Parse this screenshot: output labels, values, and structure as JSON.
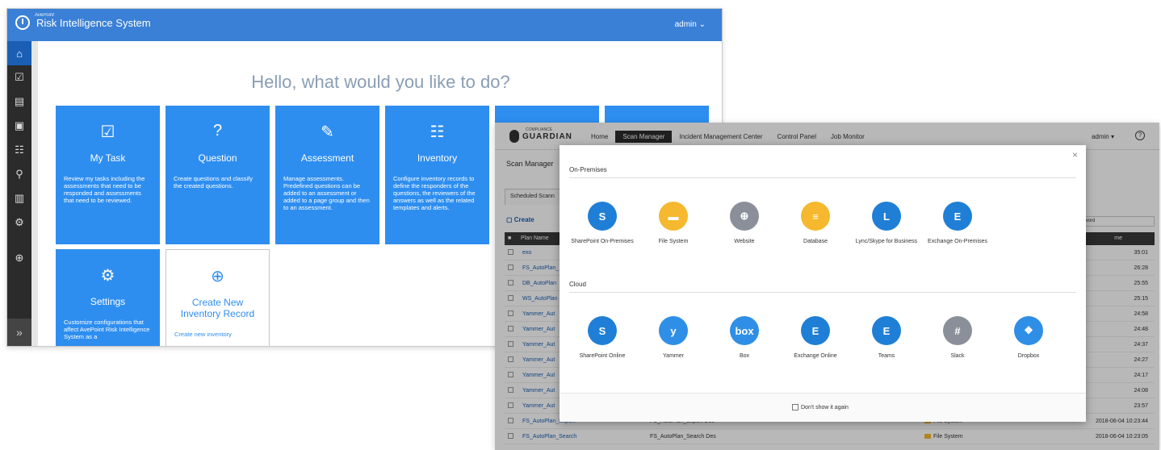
{
  "risk_app": {
    "brand_sub": "AvePoint",
    "title": "Risk Intelligence System",
    "user": "admin ⌄",
    "greeting": "Hello, what would you like to do?",
    "sidebar_icons": [
      "home-icon",
      "task-icon",
      "question-icon",
      "assessment-icon",
      "inventory-icon",
      "hierarchy-icon",
      "report-icon",
      "settings-icon",
      "add-icon"
    ],
    "tiles": [
      {
        "title": "My Task",
        "icon": "☑",
        "desc": "Review my tasks including the assessments that need to be responded and assessments that need to be reviewed."
      },
      {
        "title": "Question",
        "icon": "?",
        "desc": "Create questions and classify the created questions."
      },
      {
        "title": "Assessment",
        "icon": "✎",
        "desc": "Manage assessments. Predefined questions can be added to an assessment or added to a page group and then to an assessment."
      },
      {
        "title": "Inventory",
        "icon": "☷",
        "desc": "Configure inventory records to define the responders of the questions, the reviewers of the answers as well as the related templates and alerts."
      },
      {
        "title": "Settings",
        "icon": "⚙",
        "desc": "Customize configurations that affect AvePoint Risk Intelligence System as a"
      },
      {
        "title": "Create New Inventory Record",
        "icon": "⊕",
        "desc": "Create new inventory"
      }
    ]
  },
  "guardian_app": {
    "logo_sub": "COMPLIANCE",
    "logo": "GUARDIAN",
    "nav": [
      "Home",
      "Scan Manager",
      "Incident Management Center",
      "Control Panel",
      "Job Monitor"
    ],
    "user": "admin ▾",
    "help": "?",
    "page_title": "Scan Manager",
    "tab": "Scheduled Scann",
    "create": "Create",
    "keyword_placeholder": "eyword",
    "col_plan": "Plan Name",
    "col_time": "me",
    "rows": [
      {
        "name": "exo",
        "desc": "",
        "type": "",
        "time": "35:01"
      },
      {
        "name": "FS_AutoPlan_",
        "desc": "",
        "type": "",
        "time": "26:28"
      },
      {
        "name": "DB_AutoPlan",
        "desc": "",
        "type": "",
        "time": "25:55"
      },
      {
        "name": "WS_AutoPlan",
        "desc": "",
        "type": "",
        "time": "25:15"
      },
      {
        "name": "Yammer_Aut",
        "desc": "",
        "type": "",
        "time": "24:58"
      },
      {
        "name": "Yammer_Aut",
        "desc": "",
        "type": "",
        "time": "24:48"
      },
      {
        "name": "Yammer_Aut",
        "desc": "",
        "type": "",
        "time": "24:37"
      },
      {
        "name": "Yammer_Aut",
        "desc": "",
        "type": "",
        "time": "24:27"
      },
      {
        "name": "Yammer_Aut",
        "desc": "",
        "type": "",
        "time": "24:17"
      },
      {
        "name": "Yammer_Aut",
        "desc": "",
        "type": "",
        "time": "24:08"
      },
      {
        "name": "Yammer_Aut",
        "desc": "",
        "type": "",
        "time": "23:57"
      },
      {
        "name": "FS_AutoPlan_Export",
        "desc": "FS_AutoPlan_Export Des",
        "type": "File System",
        "time": "2018-06-04 10:23:44"
      },
      {
        "name": "FS_AutoPlan_Search",
        "desc": "FS_AutoPlan_Search Des",
        "type": "File System",
        "time": "2018-06-04 10:23:05"
      }
    ]
  },
  "modal": {
    "close": "×",
    "on_prem_title": "On-Premises",
    "cloud_title": "Cloud",
    "on_prem": [
      {
        "label": "SharePoint On-Premises",
        "glyph": "S",
        "color": "#1f7fd6"
      },
      {
        "label": "File System",
        "glyph": "▬",
        "color": "#f5b82e"
      },
      {
        "label": "Website",
        "glyph": "⊕",
        "color": "#8a8f99"
      },
      {
        "label": "Database",
        "glyph": "≡",
        "color": "#f5b82e"
      },
      {
        "label": "Lync/Skype for Business",
        "glyph": "L",
        "color": "#1f7fd6"
      },
      {
        "label": "Exchange On-Premises",
        "glyph": "E",
        "color": "#1f7fd6"
      }
    ],
    "cloud": [
      {
        "label": "SharePoint Online",
        "glyph": "S",
        "color": "#1f7fd6"
      },
      {
        "label": "Yammer",
        "glyph": "y",
        "color": "#2f8fe6"
      },
      {
        "label": "Box",
        "glyph": "box",
        "color": "#2f8fe6"
      },
      {
        "label": "Exchange Online",
        "glyph": "E",
        "color": "#1f7fd6"
      },
      {
        "label": "Teams",
        "glyph": "E",
        "color": "#1f7fd6"
      },
      {
        "label": "Slack",
        "glyph": "#",
        "color": "#8a8f99"
      },
      {
        "label": "Dropbox",
        "glyph": "❖",
        "color": "#2f8fe6"
      }
    ],
    "dont_show": "Don't show it again"
  }
}
